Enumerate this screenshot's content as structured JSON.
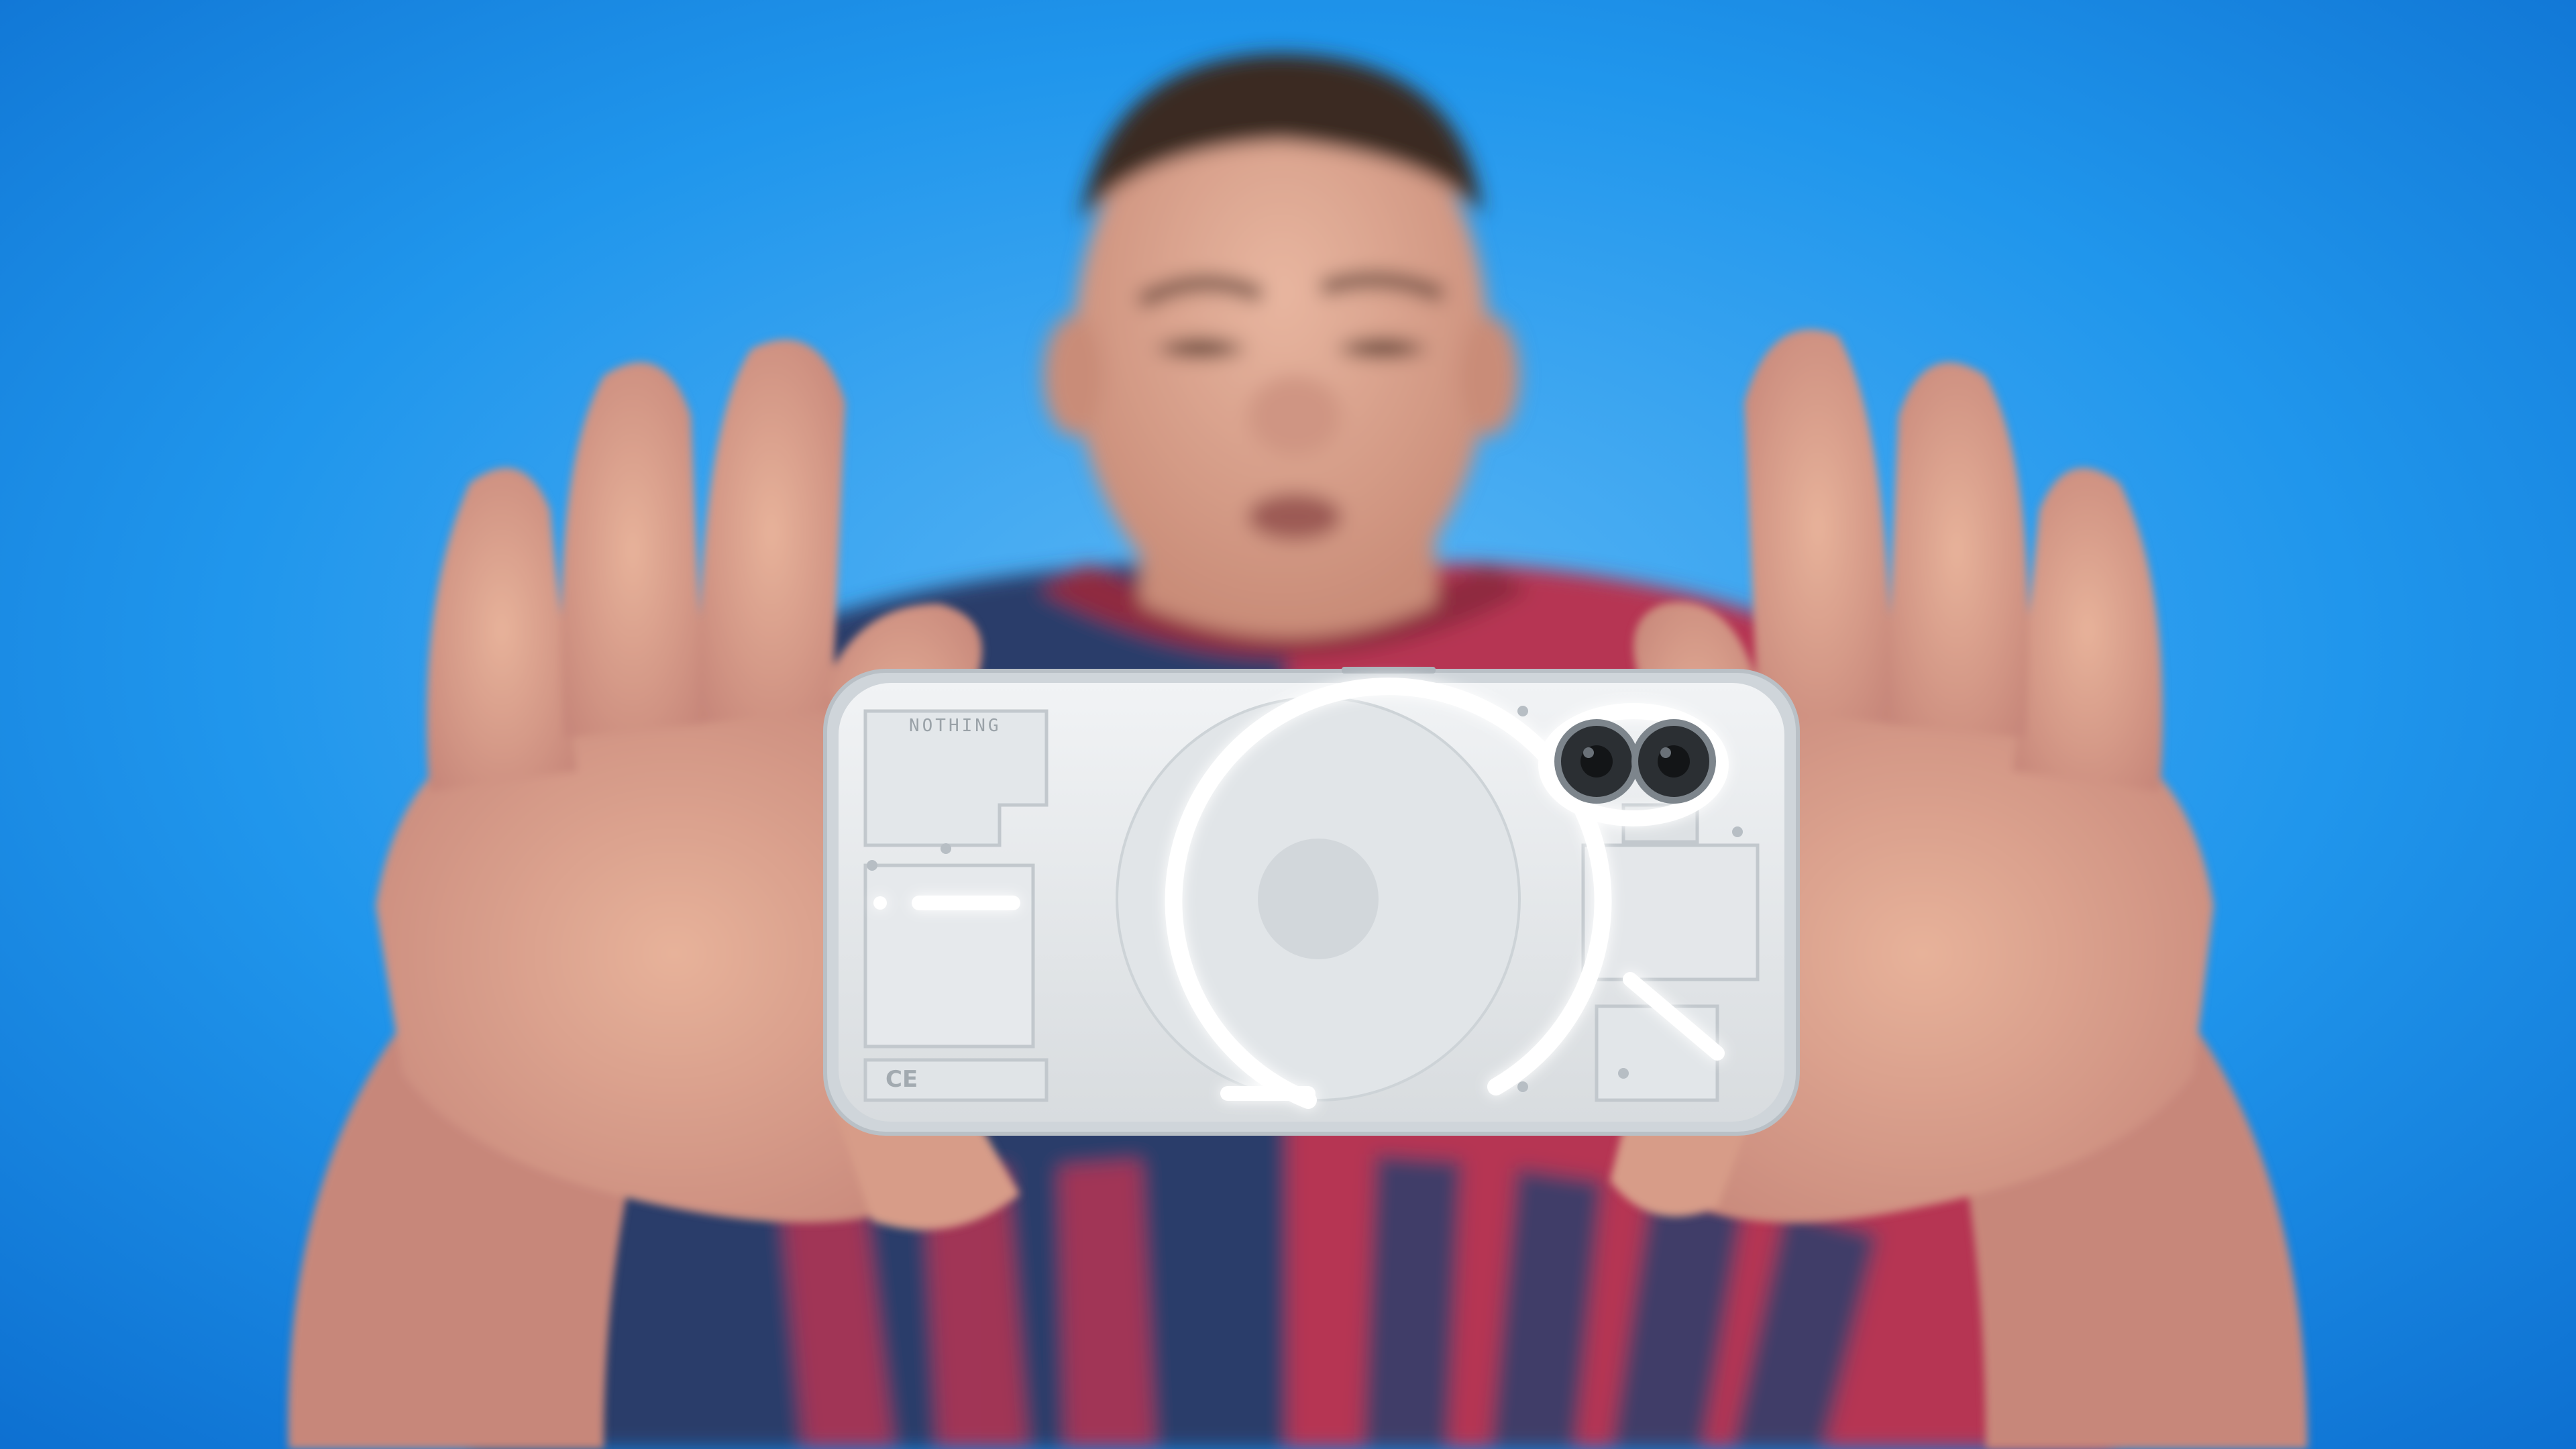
{
  "scene": {
    "background_color": "#1c8fe8",
    "subject": "person-holding-smartphone",
    "phone_color": "#e9ecef",
    "glyph_light_color": "#ffffff"
  },
  "phone_back": {
    "brand_text": "NOTHING",
    "regulatory_marks": "CE"
  },
  "shirt": {
    "colors": {
      "navy": "#2c3e6b",
      "red": "#b63552"
    }
  }
}
